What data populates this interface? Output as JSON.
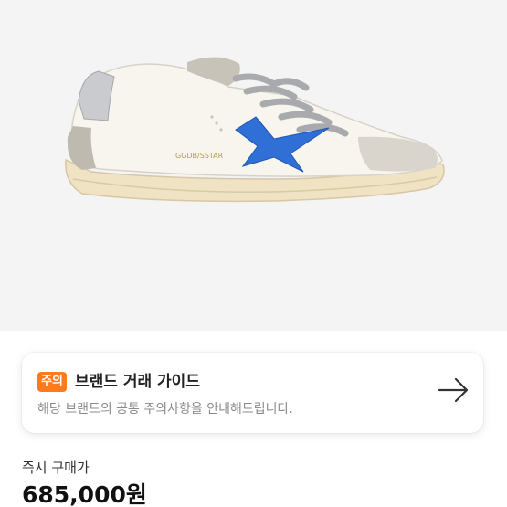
{
  "product": {
    "image_icon": "sneaker-image",
    "heel_label": "GGDB/SSTAR",
    "colors": {
      "background": "#f4f4f4",
      "star": "#2f6fd6"
    }
  },
  "guide": {
    "badge": "주의",
    "title": "브랜드 거래 가이드",
    "subtitle": "해당 브랜드의 공통 주의사항을 안내해드립니다.",
    "arrow_icon": "arrow-right-icon",
    "badge_color": "#ff7a1a"
  },
  "price": {
    "label": "즉시 구매가",
    "value": "685,000원"
  }
}
